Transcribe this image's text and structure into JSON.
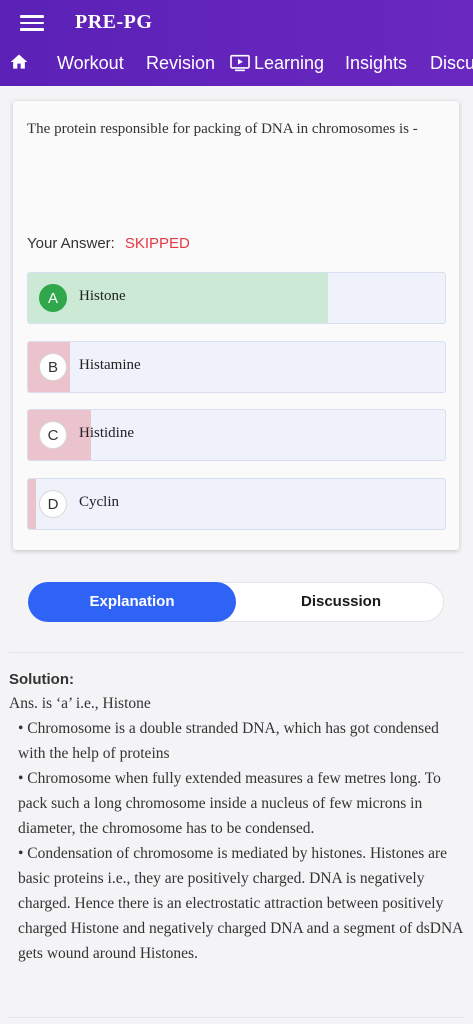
{
  "app": {
    "title": "PRE-PG"
  },
  "nav": {
    "home_icon": "home-icon",
    "items": [
      "Workout",
      "Revision",
      "Learning",
      "Insights",
      "Discu"
    ],
    "learning_icon": "video-play-icon"
  },
  "question": {
    "text": "The protein responsible for packing of DNA in chromosomes is -",
    "your_answer_label": "Your Answer:",
    "status": "SKIPPED",
    "options": [
      {
        "letter": "A",
        "text": "Histone",
        "share": 0.72,
        "state": "correct"
      },
      {
        "letter": "B",
        "text": "Histamine",
        "share": 0.1,
        "state": "wrong"
      },
      {
        "letter": "C",
        "text": "Histidine",
        "share": 0.15,
        "state": "wrong"
      },
      {
        "letter": "D",
        "text": "Cyclin",
        "share": 0.02,
        "state": "wrong"
      }
    ]
  },
  "tabs": {
    "explanation": "Explanation",
    "discussion": "Discussion"
  },
  "solution": {
    "heading": "Solution:",
    "answer": "Ans. is ‘a’ i.e., Histone",
    "bullets": [
      "• Chromosome is a double stranded DNA, which has got condensed with the help of proteins",
      "• Chromosome when fully extended measures a few metres long. To pack such a long chromosome inside a nucleus of few microns in diameter, the chromosome has to be condensed.",
      "• Condensation of chromosome is mediated by histones. Histones are basic proteins i.e., they are positively charged. DNA is negatively charged. Hence there is an electrostatic attraction between positively charged Histone and negatively charged DNA and a segment of dsDNA gets wound around Histones."
    ]
  },
  "colors": {
    "header": "#5b21b6",
    "correct_fill": "#cbe9d4",
    "wrong_fill": "#eac3cc",
    "correct_badge": "#2fa74a",
    "skipped": "#e53946",
    "tab_active": "#2f63f6"
  }
}
